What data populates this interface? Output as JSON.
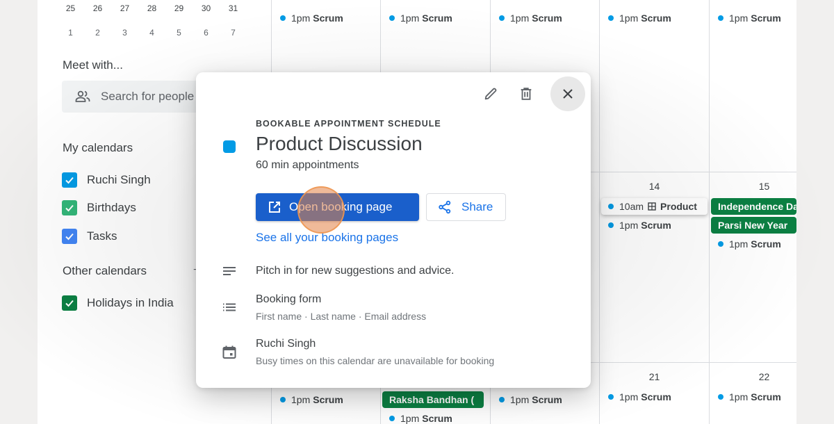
{
  "mini_calendar": {
    "row_current": [
      "25",
      "26",
      "27",
      "28",
      "29",
      "30",
      "31"
    ],
    "row_next": [
      "1",
      "2",
      "3",
      "4",
      "5",
      "6",
      "7"
    ]
  },
  "meet_with": {
    "title": "Meet with...",
    "search_placeholder": "Search for people",
    "icon": "people-icon"
  },
  "my_calendars": {
    "title": "My calendars",
    "items": [
      {
        "label": "Ruchi Singh",
        "checked": true,
        "color": "#039be5"
      },
      {
        "label": "Birthdays",
        "checked": true,
        "color": "#33b679"
      },
      {
        "label": "Tasks",
        "checked": true,
        "color": "#4285f4"
      }
    ]
  },
  "other_calendars": {
    "title": "Other calendars",
    "add_icon": "plus-icon",
    "items": [
      {
        "label": "Holidays in India",
        "checked": true,
        "color": "#0b8043"
      }
    ]
  },
  "grid": {
    "event_color": "#039be5",
    "holiday_color": "#0b8043",
    "week_top": {
      "cells": [
        {
          "events": [
            {
              "time": "1pm",
              "title": "Scrum"
            }
          ]
        },
        {
          "events": [
            {
              "time": "1pm",
              "title": "Scrum"
            }
          ]
        },
        {
          "events": [
            {
              "time": "1pm",
              "title": "Scrum"
            }
          ]
        },
        {
          "events": [
            {
              "time": "1pm",
              "title": "Scrum"
            }
          ]
        },
        {
          "events": [
            {
              "time": "1pm",
              "title": "Scrum"
            }
          ]
        }
      ]
    },
    "week_mid": {
      "cells": [
        {
          "day": "",
          "events": []
        },
        {
          "day": "",
          "events": []
        },
        {
          "day": "",
          "events": []
        },
        {
          "day": "14",
          "events": [
            {
              "time": "10am",
              "icon": "grid-schedule-icon",
              "title": "Product"
            },
            {
              "time": "1pm",
              "title": "Scrum"
            }
          ]
        },
        {
          "day": "15",
          "holidays": [
            "Independence Day",
            "Parsi New Year"
          ],
          "events": [
            {
              "time": "1pm",
              "title": "Scrum"
            }
          ]
        }
      ]
    },
    "week_bottom": {
      "cells": [
        {
          "day": "",
          "events": [
            {
              "time": "1pm",
              "title": "Scrum"
            }
          ]
        },
        {
          "day": "",
          "holidays": [
            "Raksha Bandhan ("
          ],
          "events": [
            {
              "time": "1pm",
              "title": "Scrum"
            }
          ]
        },
        {
          "day": "",
          "events": [
            {
              "time": "1pm",
              "title": "Scrum"
            }
          ]
        },
        {
          "day": "21",
          "events": [
            {
              "time": "1pm",
              "title": "Scrum"
            }
          ]
        },
        {
          "day": "22",
          "events": [
            {
              "time": "1pm",
              "title": "Scrum"
            }
          ]
        }
      ]
    }
  },
  "popup": {
    "toolbar": {
      "edit_icon": "pencil-icon",
      "delete_icon": "trash-icon",
      "close_icon": "close-icon"
    },
    "kicker": "BOOKABLE APPOINTMENT SCHEDULE",
    "color": "#039be5",
    "title": "Product Discussion",
    "subtitle": "60 min appointments",
    "open_booking_label": "Open booking page",
    "share_label": "Share",
    "see_all_label": "See all your booking pages",
    "description": "Pitch in for new suggestions and advice.",
    "booking_form": {
      "title": "Booking form",
      "fields": "First name · Last name · Email address"
    },
    "calendar": {
      "name": "Ruchi Singh",
      "note": "Busy times on this calendar are unavailable for booking"
    }
  }
}
